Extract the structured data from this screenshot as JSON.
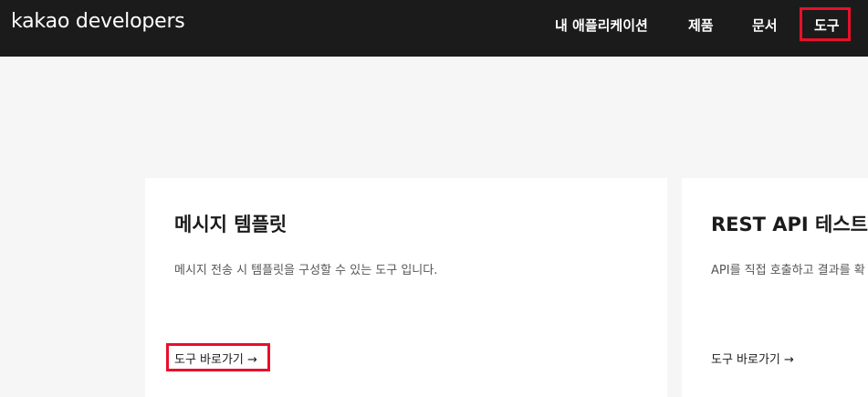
{
  "header": {
    "logo_text": "kakao developers",
    "nav": {
      "my_apps": "내 애플리케이션",
      "products": "제품",
      "docs": "문서",
      "tools": "도구"
    }
  },
  "cards": [
    {
      "title": "메시지 템플릿",
      "description": "메시지 전송 시 템플릿을 구성할 수 있는 도구 입니다.",
      "link": "도구 바로가기 →"
    },
    {
      "title": "REST API 테스트",
      "description": "API를 직접 호출하고 결과를 확",
      "link": "도구 바로가기 →"
    }
  ],
  "colors": {
    "header_bg": "#1b1b1b",
    "page_bg": "#f5f6f5",
    "card_bg": "#ffffff",
    "highlight": "#e8102a"
  }
}
